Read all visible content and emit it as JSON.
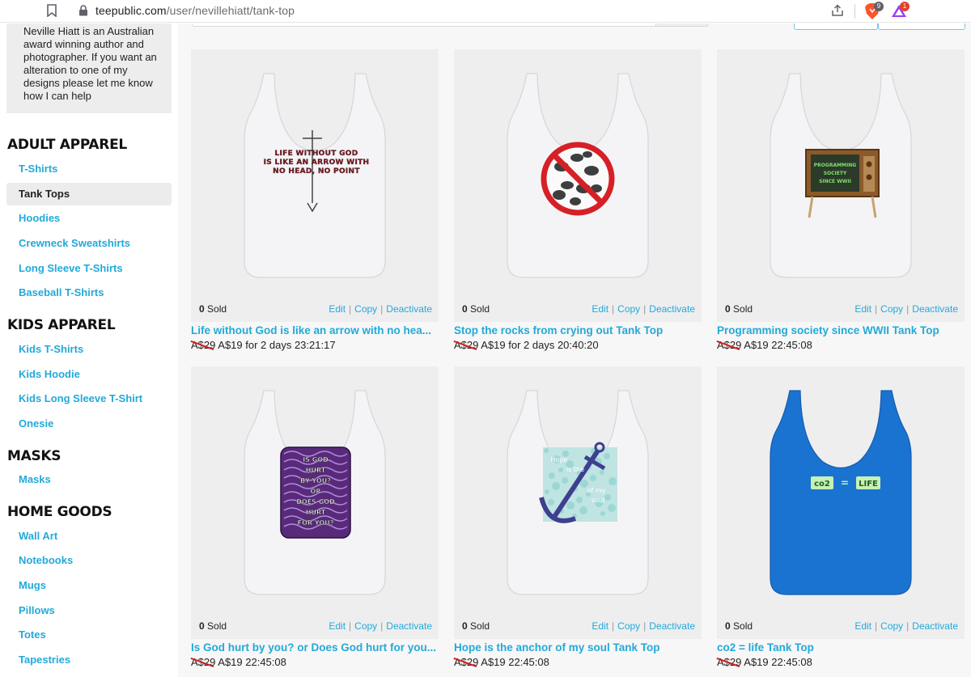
{
  "browser": {
    "url_host": "teepublic.com",
    "url_path": "/user/nevillehiatt/tank-top",
    "brave_badge": "9",
    "rewards_badge": "1"
  },
  "sidebar": {
    "bio": "Neville Hiatt is an Australian award winning author and photographer. If you want an alteration to one of my designs please let me know how I can help",
    "sections": [
      {
        "heading": "ADULT APPAREL",
        "items": [
          "T-Shirts",
          "Tank Tops",
          "Hoodies",
          "Crewneck Sweatshirts",
          "Long Sleeve T-Shirts",
          "Baseball T-Shirts"
        ]
      },
      {
        "heading": "KIDS APPAREL",
        "items": [
          "Kids T-Shirts",
          "Kids Hoodie",
          "Kids Long Sleeve T-Shirt",
          "Onesie"
        ]
      },
      {
        "heading": "MASKS",
        "items": [
          "Masks"
        ]
      },
      {
        "heading": "HOME GOODS",
        "items": [
          "Wall Art",
          "Notebooks",
          "Mugs",
          "Pillows",
          "Totes",
          "Tapestries"
        ]
      }
    ],
    "active_item": "Tank Tops"
  },
  "actions": {
    "edit": "Edit",
    "copy": "Copy",
    "deactivate": "Deactivate",
    "separator": "|"
  },
  "products": [
    {
      "sold_count": "0",
      "sold_label": "Sold",
      "title": "Life without God is like an arrow with no hea...",
      "old_price": "A$29",
      "price": "A$19 for 2 days 23:21:17",
      "shirt_color": "#f4f4f6",
      "design": "arrow-text"
    },
    {
      "sold_count": "0",
      "sold_label": "Sold",
      "title": "Stop the rocks from crying out Tank Top",
      "old_price": "A$29",
      "price": "A$19 for 2 days 20:40:20",
      "shirt_color": "#f4f4f6",
      "design": "no-rocks"
    },
    {
      "sold_count": "0",
      "sold_label": "Sold",
      "title": "Programming society since WWII Tank Top",
      "old_price": "A$29",
      "price": "A$19 22:45:08",
      "shirt_color": "#f4f4f6",
      "design": "retro-tv"
    },
    {
      "sold_count": "0",
      "sold_label": "Sold",
      "title": "Is God hurt by you? or Does God hurt for you...",
      "old_price": "A$29",
      "price": "A$19 22:45:08",
      "shirt_color": "#f4f4f6",
      "design": "purple-panel"
    },
    {
      "sold_count": "0",
      "sold_label": "Sold",
      "title": "Hope is the anchor of my soul Tank Top",
      "old_price": "A$29",
      "price": "A$19 22:45:08",
      "shirt_color": "#f4f4f6",
      "design": "anchor"
    },
    {
      "sold_count": "0",
      "sold_label": "Sold",
      "title": "co2 = life Tank Top",
      "old_price": "A$29",
      "price": "A$19 22:45:08",
      "shirt_color": "#1a73d1",
      "design": "co2-life"
    }
  ],
  "design_text": {
    "arrow": [
      "LIFE WITHOUT GOD",
      "IS LIKE AN ARROW WITH",
      "NO HEAD, NO POINT"
    ],
    "tv": [
      "PROGRAMMING",
      "SOCIETY",
      "SINCE WWII"
    ],
    "purple": [
      "IS GOD",
      "HURT",
      "BY YOU?",
      "OR",
      "DOES GOD",
      "HURT",
      "FOR YOU?"
    ],
    "anchor": [
      "Hope",
      "is the",
      "anchor",
      "of my",
      "soul"
    ],
    "co2": [
      "co2",
      "=",
      "LIFE"
    ]
  }
}
